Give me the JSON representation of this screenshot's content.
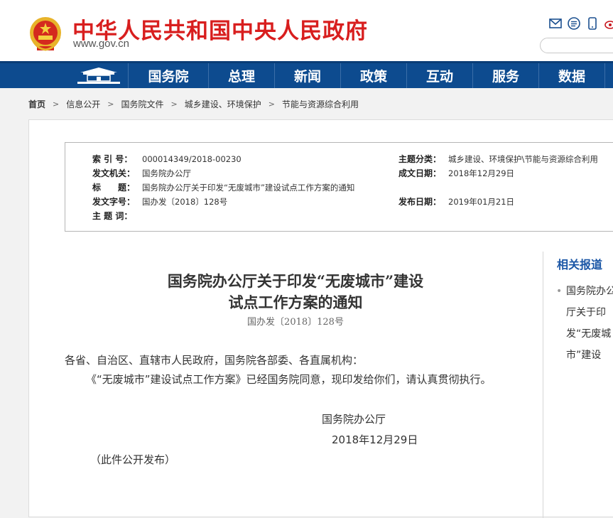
{
  "header": {
    "site_title": "中华人民共和国中央人民政府",
    "site_url": "www.gov.cn"
  },
  "nav": {
    "items": [
      "国务院",
      "总理",
      "新闻",
      "政策",
      "互动",
      "服务",
      "数据"
    ]
  },
  "breadcrumb": [
    "首页",
    "信息公开",
    "国务院文件",
    "城乡建设、环境保护",
    "节能与资源综合利用"
  ],
  "meta": {
    "index_label": "索 引 号：",
    "index_value": "000014349/2018-00230",
    "category_label": "主题分类：",
    "category_value": "城乡建设、环境保护\\节能与资源综合利用",
    "issuer_label": "发文机关：",
    "issuer_value": "国务院办公厅",
    "date_written_label": "成文日期：",
    "date_written_value": "2018年12月29日",
    "title_label": "标　　题：",
    "title_value": "国务院办公厅关于印发“无废城市”建设试点工作方案的通知",
    "doc_no_label": "发文字号：",
    "doc_no_value": "国办发〔2018〕128号",
    "publish_label": "发布日期：",
    "publish_value": "2019年01月21日",
    "keywords_label": "主 题 词："
  },
  "document": {
    "title_line1": "国务院办公厅关于印发“无废城市”建设",
    "title_line2": "试点工作方案的通知",
    "number": "国办发〔2018〕128号",
    "greeting": "各省、自治区、直辖市人民政府，国务院各部委、各直属机构：",
    "paragraph": "《“无废城市”建设试点工作方案》已经国务院同意，现印发给你们，请认真贯彻执行。",
    "sign_org": "国务院办公厅",
    "sign_date": "2018年12月29日",
    "note": "（此件公开发布）"
  },
  "related": {
    "title": "相关报道",
    "item": "国务院办公厅关于印发“无废城市”建设"
  },
  "colors": {
    "brand_red": "#d81e1e",
    "nav_blue": "#0d4b8f",
    "link_blue": "#1a56a6"
  },
  "icons": [
    "national-emblem-icon",
    "mail-icon",
    "list-icon",
    "mobile-icon",
    "weibo-icon",
    "home-gate-icon",
    "chevron-right-icon"
  ]
}
